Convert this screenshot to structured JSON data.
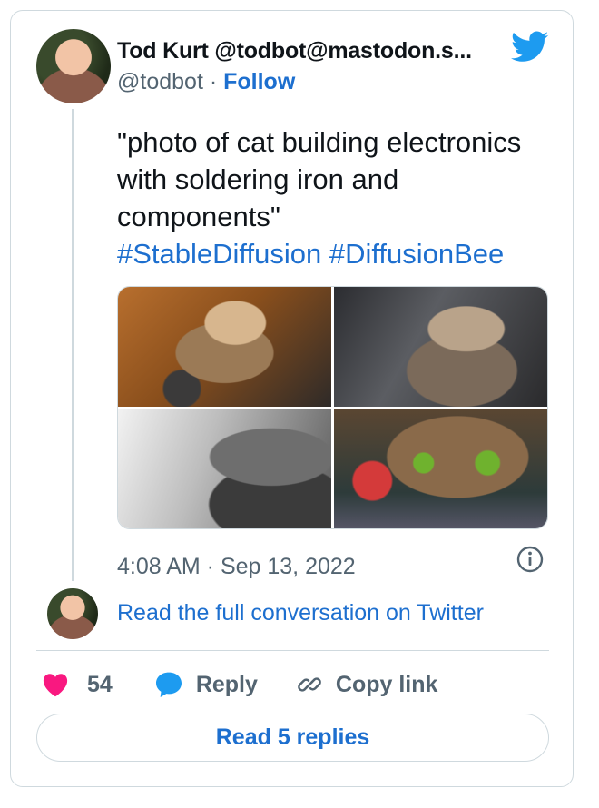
{
  "author": {
    "name": "Tod Kurt @todbot@mastodon.s...",
    "handle": "@todbot",
    "separator": "·",
    "follow_label": "Follow"
  },
  "tweet": {
    "text": "\"photo of cat building electronics with soldering iron and components\"",
    "hashtags": [
      "#StableDiffusion",
      "#DiffusionBee"
    ],
    "timestamp": "4:08 AM · Sep 13, 2022"
  },
  "read_full_label": "Read the full conversation on Twitter",
  "actions": {
    "like_count": "54",
    "reply_label": "Reply",
    "copy_link_label": "Copy link"
  },
  "read_replies_label": "Read 5 replies",
  "colors": {
    "link_blue": "#1d6fcf",
    "twitter_blue": "#1d9bf0",
    "like_pink": "#f91880",
    "text_gray": "#536471",
    "border": "#cfd9de"
  },
  "icons": {
    "brand": "twitter-bird-icon",
    "info": "info-circle-icon",
    "like": "heart-icon",
    "reply": "speech-bubble-icon",
    "copy": "link-chain-icon"
  }
}
